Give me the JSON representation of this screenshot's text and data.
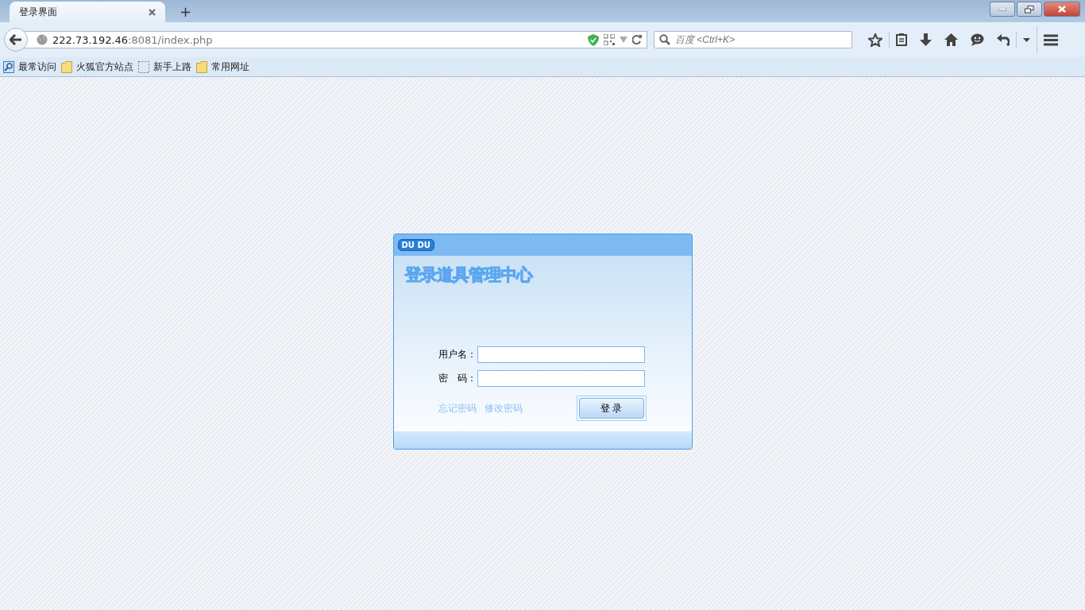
{
  "window": {
    "tab": {
      "title": "登录界面",
      "selected": true
    },
    "new_tab": "+"
  },
  "address_bar": {
    "host": "222.73.192.46",
    "rest": ":8081/index.php"
  },
  "search": {
    "placeholder": "百度 <Ctrl+K>"
  },
  "bookmarks": [
    {
      "label": "最常访问",
      "kind": "smart"
    },
    {
      "label": "火狐官方站点",
      "kind": "folder"
    },
    {
      "label": "新手上路",
      "kind": "empty"
    },
    {
      "label": "常用网址",
      "kind": "folder"
    }
  ],
  "login": {
    "logo": "DU DU",
    "title": "登录道具管理中心",
    "fields": [
      {
        "label": "用户名："
      },
      {
        "label": "密　码："
      }
    ],
    "links": [
      "忘记密码",
      "修改密码"
    ],
    "button": "登 录"
  }
}
